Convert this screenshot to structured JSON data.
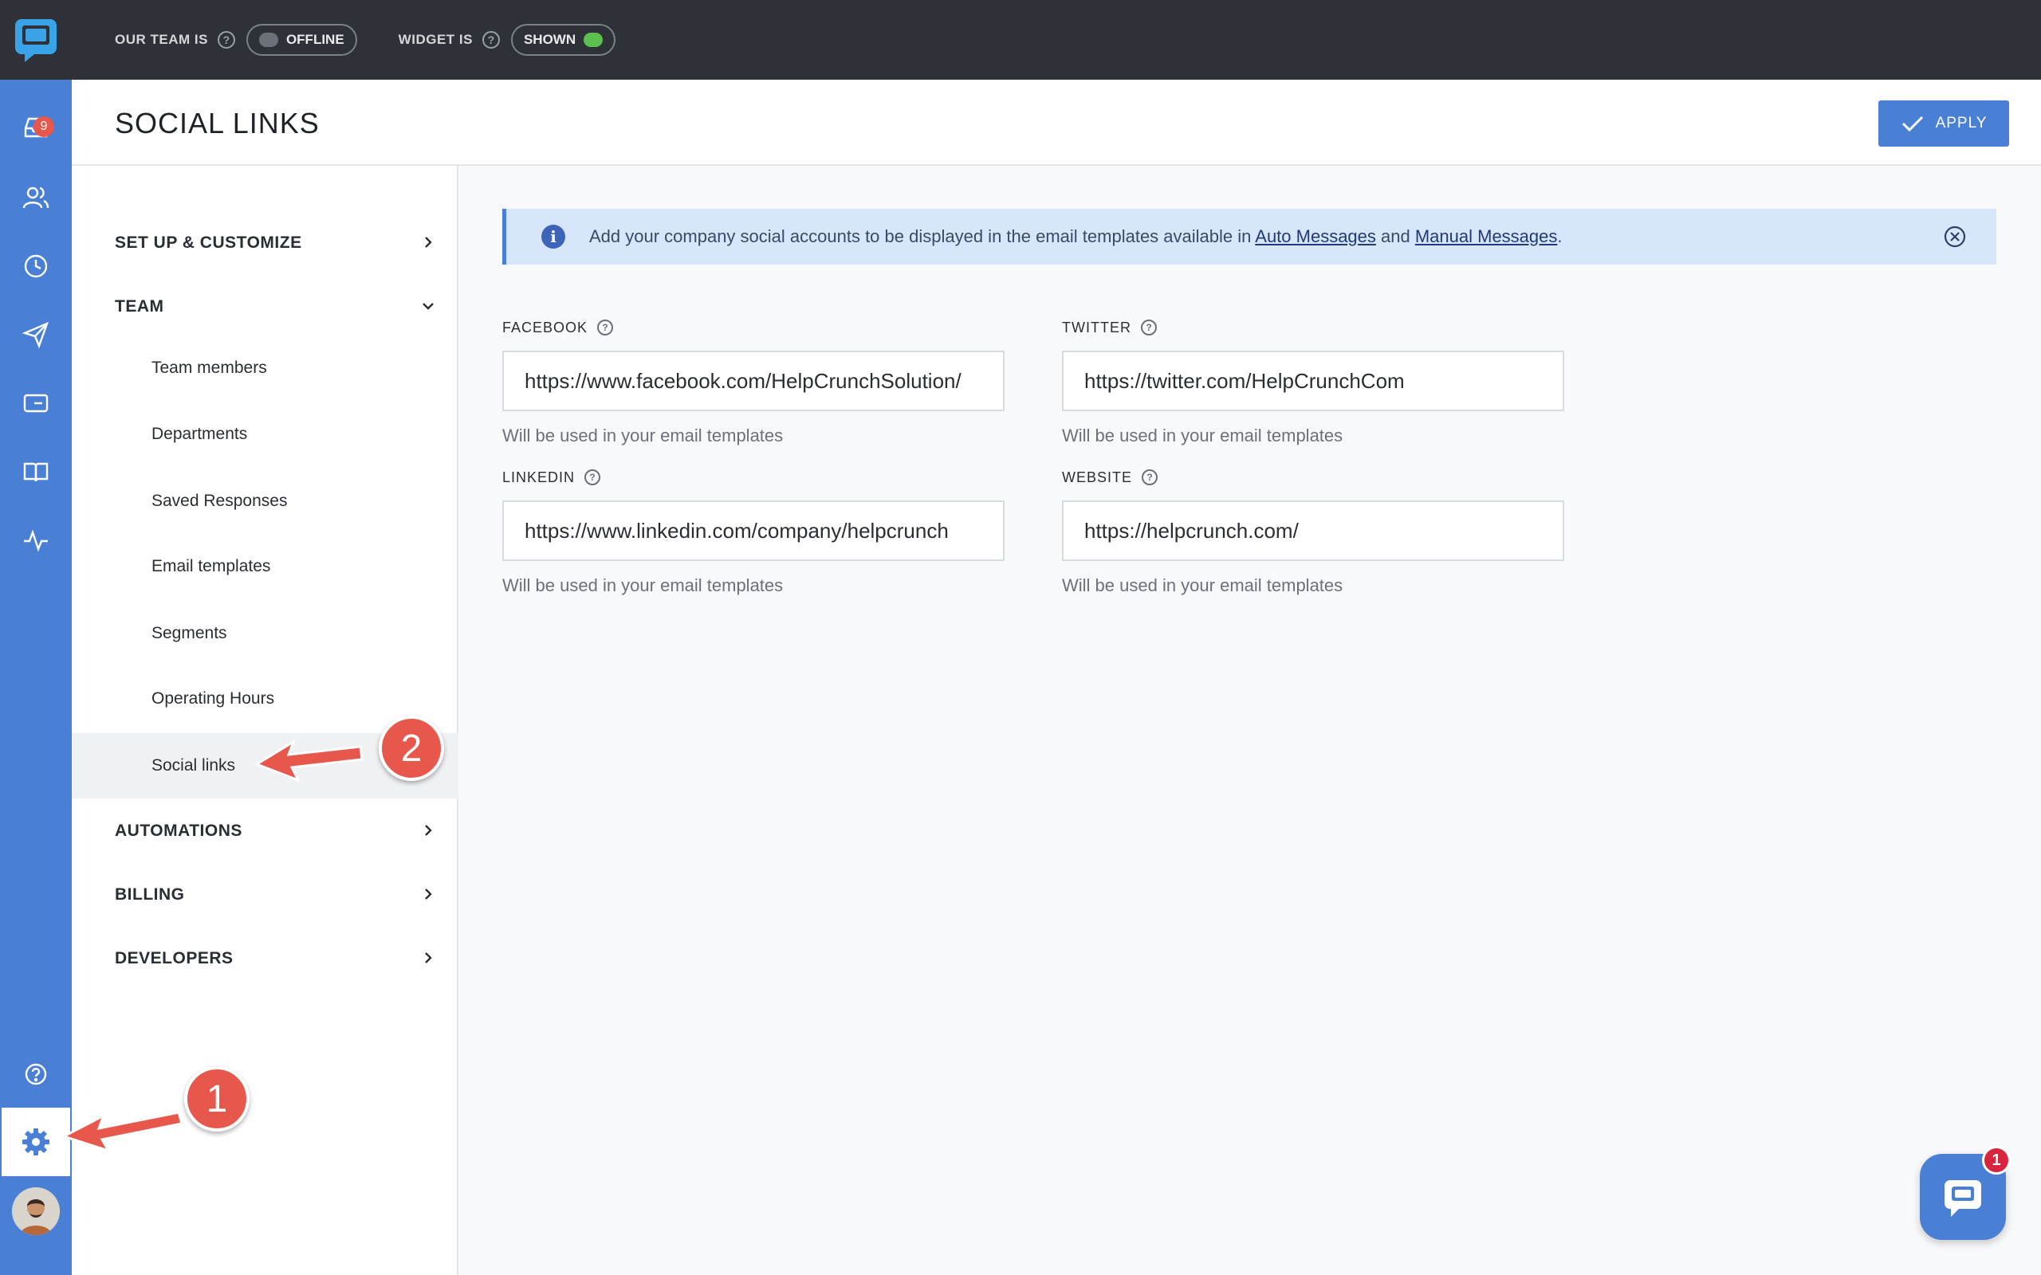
{
  "topbar": {
    "team_label": "OUR TEAM IS",
    "team_status": "OFFLINE",
    "widget_label": "WIDGET IS",
    "widget_status": "SHOWN"
  },
  "rail": {
    "inbox_badge": "9",
    "items": [
      "inbox-icon",
      "users-icon",
      "clock-icon",
      "send-icon",
      "widget-icon",
      "book-icon",
      "activity-icon",
      "help-icon",
      "gear-icon",
      "avatar"
    ]
  },
  "header": {
    "title": "SOCIAL LINKS",
    "apply_label": "APPLY"
  },
  "sidebar": {
    "setup": "SET UP & CUSTOMIZE",
    "team": "TEAM",
    "team_items": [
      "Team members",
      "Departments",
      "Saved Responses",
      "Email templates",
      "Segments",
      "Operating Hours",
      "Social links"
    ],
    "automations": "AUTOMATIONS",
    "billing": "BILLING",
    "developers": "DEVELOPERS"
  },
  "banner": {
    "text_before": "Add your company social accounts to be displayed in the email templates available in ",
    "link1": "Auto Messages",
    "and": " and ",
    "link2": "Manual Messages",
    "period": "."
  },
  "fields": {
    "facebook": {
      "label": "FACEBOOK",
      "value": "https://www.facebook.com/HelpCrunchSolution/",
      "help": "Will be used in your email templates"
    },
    "twitter": {
      "label": "TWITTER",
      "value": "https://twitter.com/HelpCrunchCom",
      "help": "Will be used in your email templates"
    },
    "linkedin": {
      "label": "LINKEDIN",
      "value": "https://www.linkedin.com/company/helpcrunch",
      "help": "Will be used in your email templates"
    },
    "website": {
      "label": "WEBSITE",
      "value": "https://helpcrunch.com/",
      "help": "Will be used in your email templates"
    }
  },
  "annotations": {
    "step1": "1",
    "step2": "2"
  },
  "chat_widget": {
    "badge": "1"
  },
  "colors": {
    "accent": "#4a7fd6",
    "topbar": "#2e3138",
    "annotation": "#e8574b"
  }
}
